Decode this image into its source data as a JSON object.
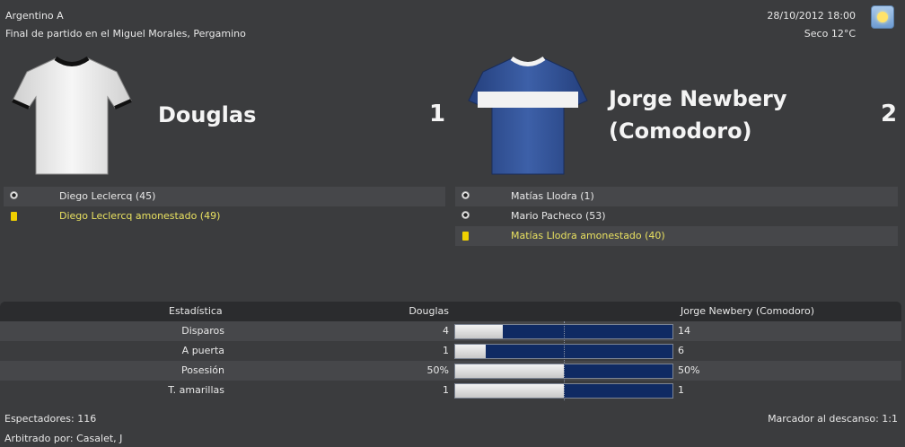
{
  "header": {
    "competition": "Argentino A",
    "venue": "Final de partido en el Miguel Morales, Pergamino",
    "datetime": "28/10/2012 18:00",
    "weather": "Seco 12°C",
    "weather_icon": "sun-icon"
  },
  "home": {
    "name": "Douglas",
    "score": "1",
    "events": [
      {
        "type": "goal",
        "text": "Diego Leclercq (45)"
      },
      {
        "type": "yellow-card",
        "text": "Diego Leclercq amonestado (49)"
      }
    ]
  },
  "away": {
    "name_line1": "Jorge Newbery",
    "name_line2": "(Comodoro)",
    "score": "2",
    "events": [
      {
        "type": "goal",
        "text": "Matías Llodra (1)"
      },
      {
        "type": "goal",
        "text": "Mario Pacheco (53)"
      },
      {
        "type": "yellow-card",
        "text": "Matías Llodra amonestado (40)"
      }
    ]
  },
  "stats": {
    "header": {
      "label": "Estadística",
      "home": "Douglas",
      "away": "Jorge Newbery (Comodoro)"
    },
    "rows": [
      {
        "label": "Disparos",
        "home": "4",
        "away": "14",
        "home_share": 0.22
      },
      {
        "label": "A puerta",
        "home": "1",
        "away": "6",
        "home_share": 0.14
      },
      {
        "label": "Posesión",
        "home": "50%",
        "away": "50%",
        "home_share": 0.5
      },
      {
        "label": "T. amarillas",
        "home": "1",
        "away": "1",
        "home_share": 0.5
      }
    ]
  },
  "footer": {
    "spectators": "Espectadores: 116",
    "referee": "Arbitrado por: Casalet, J",
    "halftime": "Marcador al descanso: 1:1"
  },
  "colors": {
    "away_bar": "#0f2a63",
    "card_text": "#e8e060",
    "home_shirt": "#f2f2f2",
    "away_shirt": "#2e4f95"
  }
}
